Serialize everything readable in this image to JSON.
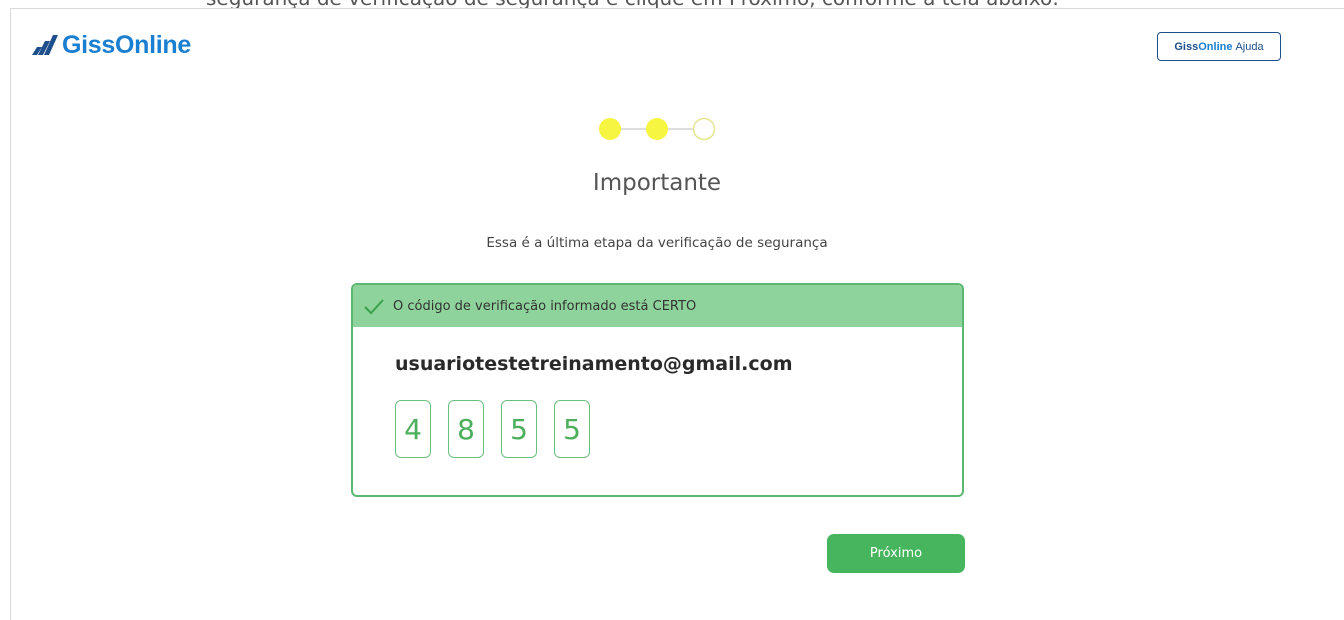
{
  "header": {
    "top_text": "segurança de verificação de segurança e clique em Próximo, conforme a tela abaixo:",
    "logo_text": "GissOnline",
    "help_button": {
      "brand_giss": "Giss",
      "brand_online": "Online",
      "label": "Ajuda"
    }
  },
  "stepper": {
    "total_steps": 3,
    "completed_steps": 2,
    "active_color": "#f5f542",
    "inactive_color": "#ffffff"
  },
  "main": {
    "title": "Importante",
    "subtitle": "Essa é a última etapa da verificação de segurança"
  },
  "verification": {
    "success_message": "O código de verificação informado está CERTO",
    "email": "usuariotestetreinamento@gmail.com",
    "code_digits": [
      "4",
      "8",
      "5",
      "5"
    ],
    "success_color": "#46b55e"
  },
  "actions": {
    "next_label": "Próximo"
  }
}
